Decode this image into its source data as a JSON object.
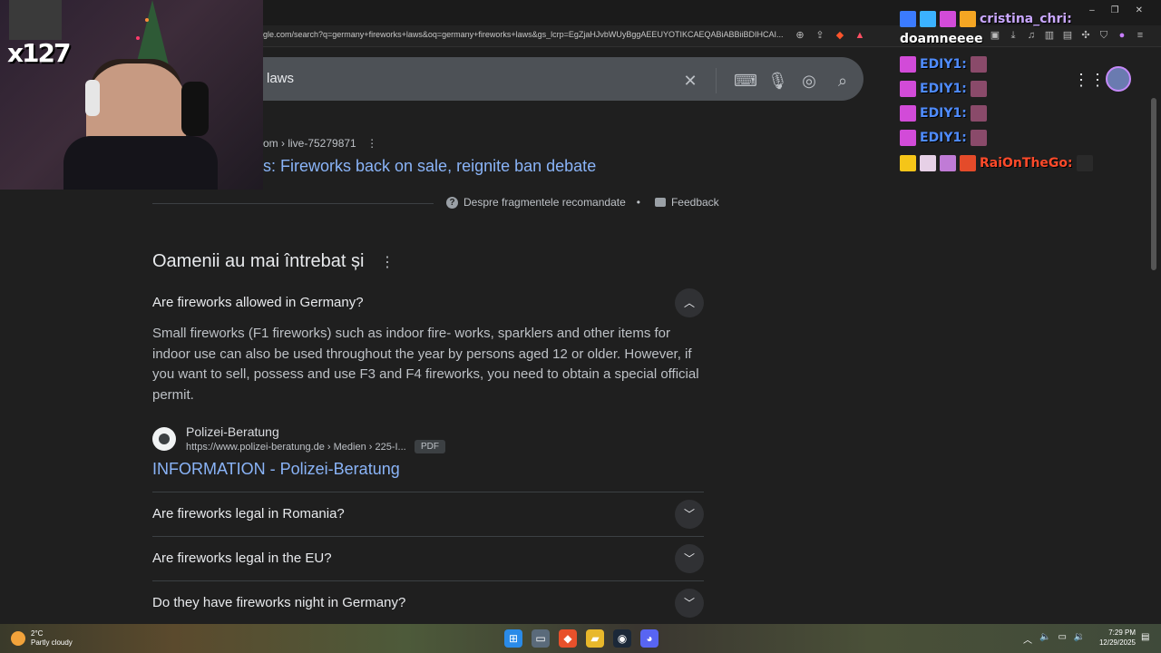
{
  "browser": {
    "url": "gle.com/search?q=germany+fireworks+laws&oq=germany+fireworks+laws&gs_lcrp=EgZjaHJvbWUyBggAEEUYOTIKCAEQABiABBiiBDIHCAI...",
    "window_controls": [
      "–",
      "❐",
      "✕"
    ]
  },
  "search": {
    "query_visible": "laws"
  },
  "top_result": {
    "cite": "om › live-75279871",
    "title": "s: Fireworks back on sale, reignite ban debate"
  },
  "about_snippets": {
    "label": "Despre fragmentele recomandate",
    "feedback": "Feedback"
  },
  "paa": {
    "title": "Oamenii au mai întrebat și",
    "questions": [
      {
        "text": "Are fireworks allowed in Germany?",
        "expanded": true
      },
      {
        "text": "Are fireworks legal in Romania?",
        "expanded": false
      },
      {
        "text": "Are fireworks legal in the EU?",
        "expanded": false
      },
      {
        "text": "Do they have fireworks night in Germany?",
        "expanded": false
      }
    ],
    "answer": "Small fireworks (F1 fireworks) such as indoor fire- works, sparklers and other items for indoor use can also be used throughout the year by persons aged 12 or older. However, if you want to sell, possess and use F3 and F4 fireworks, you need to obtain a special official permit.",
    "source": {
      "name": "Polizei-Beratung",
      "url": "https://www.polizei-beratung.de › Medien › 225-I...",
      "badge": "PDF",
      "title": "INFORMATION - Polizei-Beratung"
    }
  },
  "stream": {
    "sub_count": "x127"
  },
  "chat": {
    "messages": [
      {
        "user": "cristina_chri:",
        "text": "doamneeee",
        "color": "#c9a7ff"
      },
      {
        "user": "EDIY1:",
        "text": "",
        "color": "#4f8cff"
      },
      {
        "user": "EDIY1:",
        "text": "",
        "color": "#4f8cff"
      },
      {
        "user": "EDIY1:",
        "text": "",
        "color": "#4f8cff"
      },
      {
        "user": "EDIY1:",
        "text": "",
        "color": "#4f8cff"
      },
      {
        "user": "RaiOnTheGo:",
        "text": "",
        "color": "#ff4a2a"
      }
    ]
  },
  "taskbar": {
    "temp": "2°C",
    "condition": "Partly cloudy",
    "time": "7:29 PM",
    "date": "12/29/2025"
  }
}
